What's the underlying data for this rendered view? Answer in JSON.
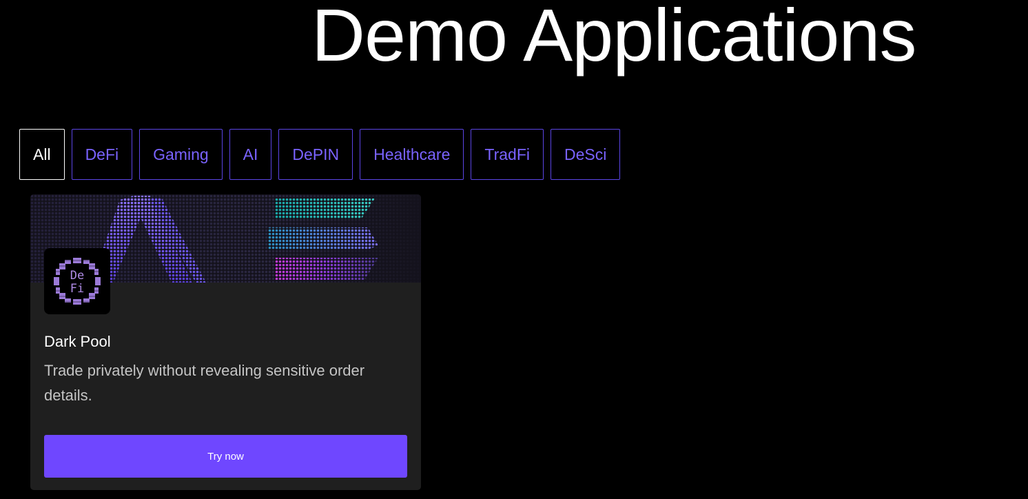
{
  "header": {
    "title": "Demo Applications"
  },
  "filters": [
    {
      "label": "All",
      "active": true
    },
    {
      "label": "DeFi",
      "active": false
    },
    {
      "label": "Gaming",
      "active": false
    },
    {
      "label": "AI",
      "active": false
    },
    {
      "label": "DePIN",
      "active": false
    },
    {
      "label": "Healthcare",
      "active": false
    },
    {
      "label": "TradFi",
      "active": false
    },
    {
      "label": "DeSci",
      "active": false
    }
  ],
  "cards": [
    {
      "logo_text_top": "De",
      "logo_text_bottom": "Fi",
      "logo_icon": "defi-gear-icon",
      "banner_icon": "arcium-banner-pattern",
      "title": "Dark Pool",
      "description": "Trade privately without revealing sensitive order details.",
      "button_label": "Try now"
    }
  ],
  "colors": {
    "background": "#000000",
    "accent": "#6f47ff",
    "filter_text": "#7a63ff",
    "filter_border": "#5b45e6",
    "card_background": "#1f1f1f",
    "description_text": "#c4c4c4"
  }
}
